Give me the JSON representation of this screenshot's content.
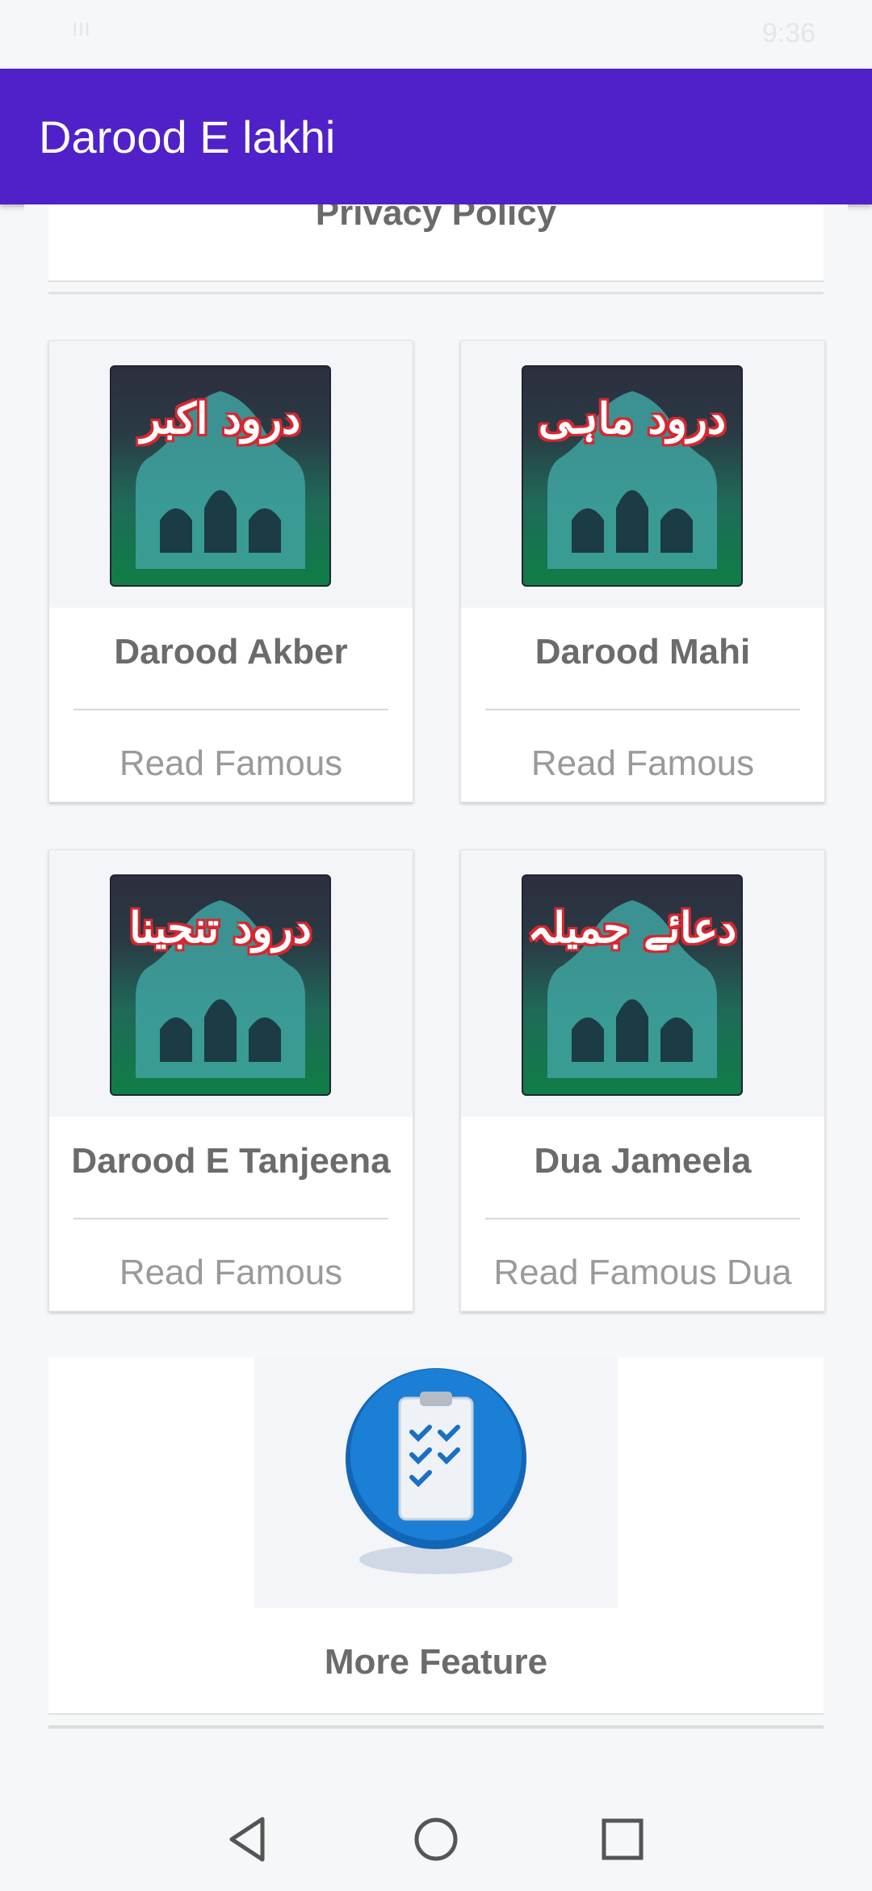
{
  "status_bar": {
    "signal": "ᴵᴵᴵ",
    "time": "9:36"
  },
  "app_bar": {
    "title": "Darood E lakhi"
  },
  "privacy": {
    "label": "Privacy Policy"
  },
  "cards": [
    {
      "title": "Darood Akber",
      "subtitle": "Read Famous",
      "image_text": "درود اکبر"
    },
    {
      "title": "Darood Mahi",
      "subtitle": "Read Famous",
      "image_text": "درود ماہی"
    },
    {
      "title": "Darood E Tanjeena",
      "subtitle": "Read Famous",
      "image_text": "درود تنجینا"
    },
    {
      "title": "Dua Jameela",
      "subtitle": "Read Famous Dua",
      "image_text": "دعائے جمیلہ"
    }
  ],
  "more": {
    "title": "More Feature"
  },
  "colors": {
    "app_bar": "#5021c9",
    "card_title": "#6b6b6b",
    "subtitle": "#9a9a9a"
  },
  "icons": [
    "mosque-image",
    "clipboard-checklist-icon",
    "back-icon",
    "home-icon",
    "recents-icon"
  ]
}
